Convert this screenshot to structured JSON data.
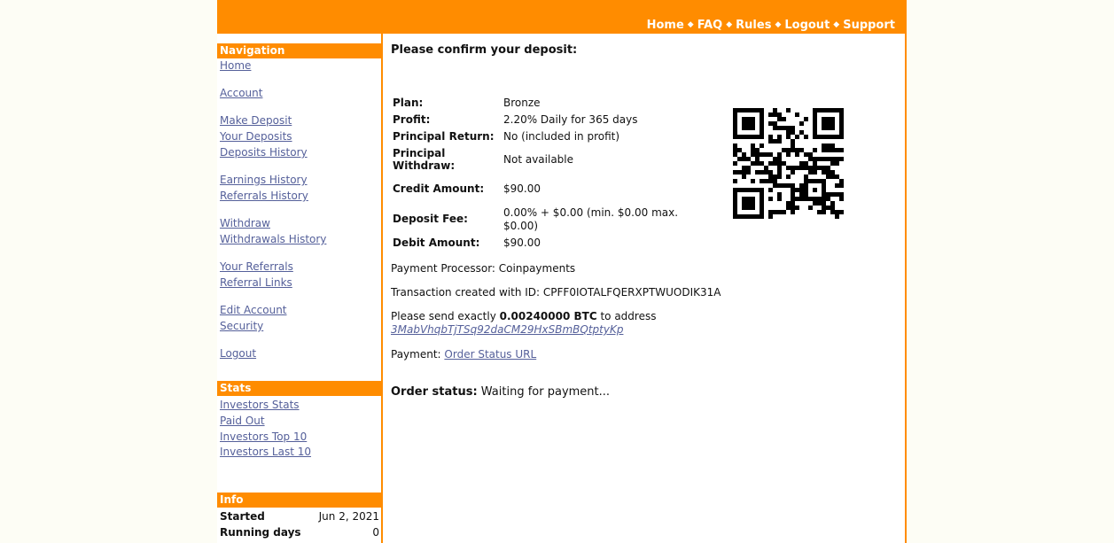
{
  "topnav": {
    "items": [
      "Home",
      "FAQ",
      "Rules",
      "Logout",
      "Support"
    ],
    "separator": "◆"
  },
  "sidebar": {
    "navigation_title": "Navigation",
    "nav": {
      "home": "Home",
      "account": "Account",
      "make_deposit": "Make Deposit",
      "your_deposits": "Your Deposits",
      "deposits_history": "Deposits History",
      "earnings_history": "Earnings History",
      "referrals_history": "Referrals History",
      "withdraw": "Withdraw",
      "withdrawals_history": "Withdrawals History",
      "your_referrals": "Your Referrals",
      "referral_links": "Referral Links",
      "edit_account": "Edit Account",
      "security": "Security",
      "logout": "Logout"
    },
    "stats_title": "Stats",
    "stats": {
      "investors_stats": "Investors Stats",
      "paid_out": "Paid Out",
      "investors_top": "Investors Top 10",
      "investors_last": "Investors Last 10"
    },
    "info_title": "Info",
    "info": {
      "started_label": "Started",
      "started_value": "Jun 2, 2021",
      "running_label": "Running days",
      "running_value": "0"
    }
  },
  "main": {
    "title": "Please confirm your deposit:",
    "details": {
      "plan_label": "Plan:",
      "plan_value": "Bronze",
      "profit_label": "Profit:",
      "profit_value": "2.20% Daily for 365 days",
      "principal_return_label": "Principal Return:",
      "principal_return_value": "No (included in profit)",
      "principal_withdraw_label_1": "Principal",
      "principal_withdraw_label_2": "Withdraw:",
      "principal_withdraw_value": "Not available",
      "credit_label": "Credit Amount:",
      "credit_value": "$90.00",
      "fee_label": "Deposit Fee:",
      "fee_value_1": "0.00% + $0.00 (min. $0.00 max.",
      "fee_value_2": "$0.00)",
      "debit_label": "Debit Amount:",
      "debit_value": "$90.00"
    },
    "processor_text": "Payment Processor: Coinpayments",
    "transaction_text": "Transaction created with ID: CPFF0IOTALFQERXPTWUODIK31A",
    "send_prefix": "Please send exactly ",
    "send_amount": "0.00240000 BTC",
    "send_suffix": " to address",
    "address": "3MabVhqbTjTSq92daCM29HxSBmBQtptyKp",
    "payment_prefix": "Payment: ",
    "order_status_link": "Order Status URL",
    "order_status_label": "Order status:",
    "order_status_value": " Waiting for payment..."
  },
  "colors": {
    "accent": "#ff8c00",
    "link": "#55609a",
    "page_background": "#fdfdf5"
  },
  "icons": {
    "qr_code": "qr-code-icon"
  }
}
